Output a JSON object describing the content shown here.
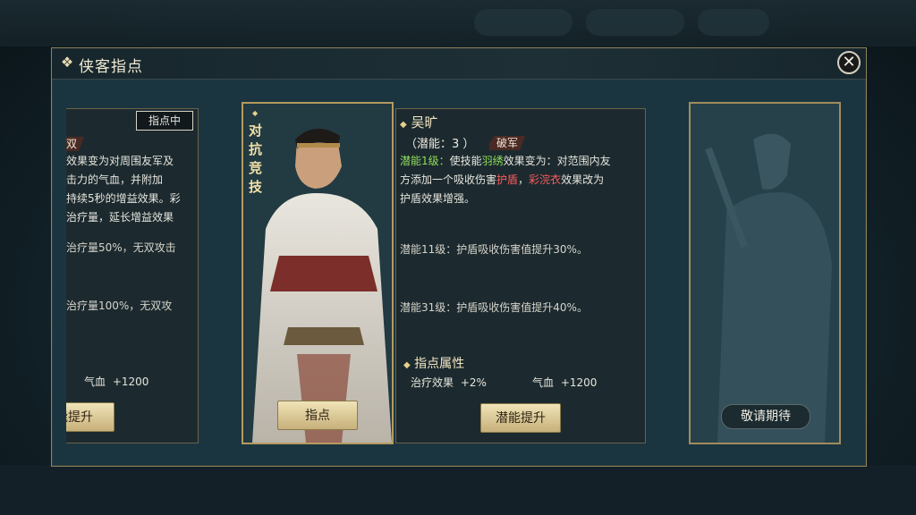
{
  "modal": {
    "title": "侠客指点",
    "close_label": "✕"
  },
  "left_panel": {
    "status_badge": "指点中",
    "tag_fragment": "双",
    "lines": [
      "效果变为对周围友军及",
      "击力的气血，并附加",
      "持续5秒的增益效果。彩",
      "治疗量，延长增益效果",
      "治疗量50%，无双攻击",
      "治疗量100%，无双攻"
    ],
    "attr_label": "气血",
    "attr_value": "+1200",
    "button": "能提升"
  },
  "card": {
    "vertical_title": [
      "对",
      "抗",
      "竞",
      "技"
    ],
    "button": "指点"
  },
  "detail": {
    "name": "吴旷",
    "potential_label": "（潜能：3 ）",
    "tag": "破军",
    "lv1_label": "潜能1级：",
    "lv1_text_a": "使技能",
    "lv1_skill": "羽绣",
    "lv1_text_b": "效果变为：对范围内友",
    "lv1_text_c": "方添加一个吸收伤害",
    "lv1_shield": "护盾",
    "lv1_text_d": "，",
    "lv1_skill2": "彩浣衣",
    "lv1_text_e": "效果改为",
    "lv1_text_f": "护盾效果增强。",
    "lv11": "潜能11级：护盾吸收伤害值提升30%。",
    "lv31": "潜能31级：护盾吸收伤害值提升40%。",
    "attr_title": "指点属性",
    "attr1_label": "治疗效果",
    "attr1_value": "+2%",
    "attr2_label": "气血",
    "attr2_value": "+1200",
    "button": "潜能提升"
  },
  "locked": {
    "label": "敬请期待"
  },
  "colors": {
    "accent_gold": "#e7d08a",
    "highlight_green": "#8fdc5a",
    "highlight_red": "#ff5b5b",
    "highlight_blue": "#66a8ff"
  }
}
